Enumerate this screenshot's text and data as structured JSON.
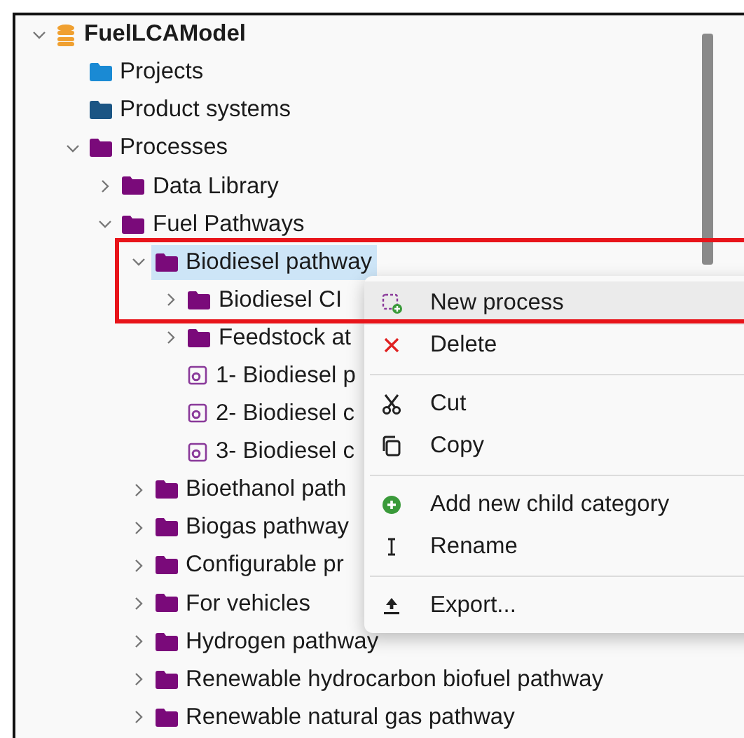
{
  "tree": [
    {
      "label": "FuelLCAModel",
      "kind": "database",
      "expanded": true,
      "selected": false,
      "children": [
        {
          "label": "Projects",
          "kind": "folder",
          "color": "#1a8ad4",
          "selected": false
        },
        {
          "label": "Product systems",
          "kind": "folder",
          "color": "#1b5584",
          "selected": false
        },
        {
          "label": "Processes",
          "kind": "folder",
          "color": "#7a0a7a",
          "expanded": true,
          "selected": false,
          "children": [
            {
              "label": "Data Library",
              "kind": "folder",
              "color": "#7a0a7a",
              "expanded": false,
              "selected": false
            },
            {
              "label": "Fuel Pathways",
              "kind": "folder",
              "color": "#7a0a7a",
              "expanded": true,
              "selected": false,
              "children": [
                {
                  "label": "Biodiesel pathway",
                  "kind": "folder",
                  "color": "#7a0a7a",
                  "expanded": true,
                  "selected": true,
                  "children": [
                    {
                      "label": "Biodiesel CI",
                      "kind": "folder",
                      "color": "#7a0a7a",
                      "expanded": false,
                      "selected": false
                    },
                    {
                      "label": "Feedstock at",
                      "kind": "folder",
                      "color": "#7a0a7a",
                      "expanded": false,
                      "selected": false
                    },
                    {
                      "label": "1- Biodiesel p",
                      "kind": "process",
                      "selected": false
                    },
                    {
                      "label": "2- Biodiesel c",
                      "kind": "process",
                      "selected": false
                    },
                    {
                      "label": "3- Biodiesel c",
                      "kind": "process",
                      "selected": false
                    }
                  ]
                },
                {
                  "label": "Bioethanol path",
                  "kind": "folder",
                  "color": "#7a0a7a",
                  "expanded": false,
                  "selected": false
                },
                {
                  "label": "Biogas pathway",
                  "kind": "folder",
                  "color": "#7a0a7a",
                  "expanded": false,
                  "selected": false
                },
                {
                  "label": "Configurable pr",
                  "kind": "folder",
                  "color": "#7a0a7a",
                  "expanded": false,
                  "selected": false
                },
                {
                  "label": "For vehicles",
                  "kind": "folder",
                  "color": "#7a0a7a",
                  "expanded": false,
                  "selected": false
                },
                {
                  "label": "Hydrogen pathway",
                  "kind": "folder",
                  "color": "#7a0a7a",
                  "expanded": false,
                  "selected": false
                },
                {
                  "label": "Renewable hydrocarbon biofuel pathway",
                  "kind": "folder",
                  "color": "#7a0a7a",
                  "expanded": false,
                  "selected": false
                },
                {
                  "label": "Renewable natural gas pathway",
                  "kind": "folder",
                  "color": "#7a0a7a",
                  "expanded": false,
                  "selected": false
                }
              ]
            }
          ]
        }
      ]
    }
  ],
  "context_menu": {
    "groups": [
      [
        {
          "label": "New process",
          "kind": "new-process",
          "selected": true
        },
        {
          "label": "Delete",
          "kind": "delete",
          "selected": false
        }
      ],
      [
        {
          "label": "Cut",
          "kind": "cut",
          "selected": false
        },
        {
          "label": "Copy",
          "kind": "copy",
          "selected": false
        }
      ],
      [
        {
          "label": "Add new child category",
          "kind": "add",
          "selected": false
        },
        {
          "label": "Rename",
          "kind": "rename",
          "selected": false
        }
      ],
      [
        {
          "label": "Export...",
          "kind": "export",
          "selected": false
        }
      ]
    ]
  },
  "annotation": {
    "kind": "highlight"
  }
}
